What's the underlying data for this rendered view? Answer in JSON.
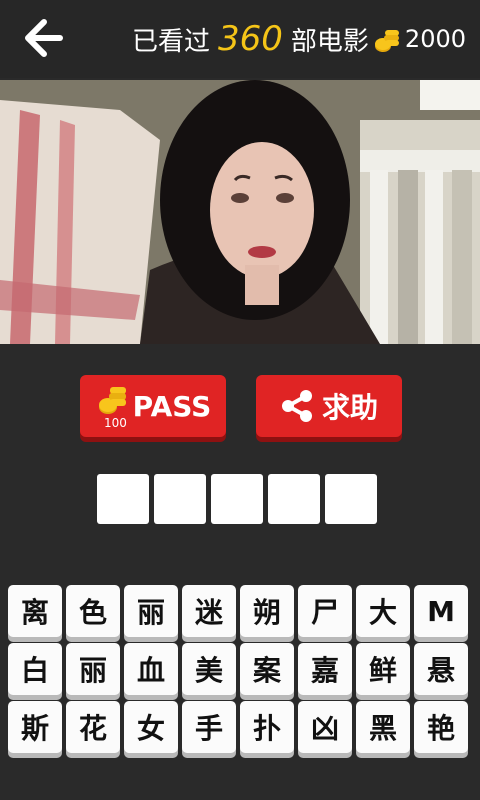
{
  "header": {
    "prefix": "已看过",
    "count": "360",
    "suffix": "部电影",
    "coins": "2000"
  },
  "buttons": {
    "pass_label": "PASS",
    "pass_cost": "100",
    "help_label": "求助"
  },
  "answer": {
    "slots": 5
  },
  "keyboard": {
    "keys": [
      "离",
      "色",
      "丽",
      "迷",
      "朔",
      "尸",
      "大",
      "M",
      "白",
      "丽",
      "血",
      "美",
      "案",
      "嘉",
      "鲜",
      "悬",
      "斯",
      "花",
      "女",
      "手",
      "扑",
      "凶",
      "黑",
      "艳"
    ]
  },
  "colors": {
    "accent_red": "#e02424",
    "coin_gold": "#f5c518",
    "background": "#2a2a2a"
  },
  "icons": {
    "back": "back-arrow-icon",
    "coin": "coin-stack-icon",
    "share": "share-icon"
  }
}
